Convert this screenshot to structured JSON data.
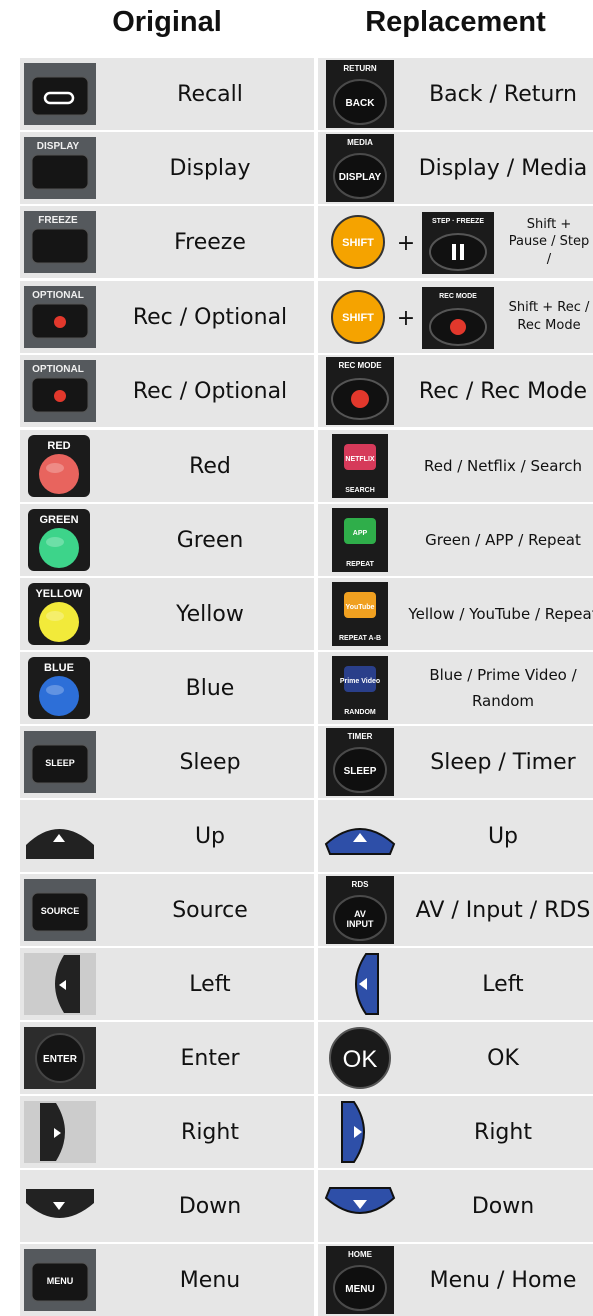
{
  "headers": {
    "original": "Original",
    "replacement": "Replacement"
  },
  "rows": [
    {
      "orig": {
        "label": "Recall",
        "key": "recall-button-icon"
      },
      "repl": {
        "label": "Back / Return",
        "key": "back-return-button-icon",
        "top": "RETURN",
        "face": "BACK"
      }
    },
    {
      "orig": {
        "label": "Display",
        "key": "display-button-icon",
        "top": "DISPLAY"
      },
      "repl": {
        "label": "Display / Media",
        "key": "display-media-button-icon",
        "top": "MEDIA",
        "face": "DISPLAY"
      }
    },
    {
      "orig": {
        "label": "Freeze",
        "key": "freeze-button-icon",
        "top": "FREEZE"
      },
      "repl": {
        "label": "Shift + Pause / Step /",
        "key": "shift-pause-button-icon",
        "face": "SHIFT",
        "top2": "STEP · FREEZE",
        "plus": "+"
      }
    },
    {
      "orig": {
        "label": "Rec / Optional",
        "key": "optional-rec-button-icon",
        "top": "OPTIONAL"
      },
      "repl": {
        "label": "Shift + Rec / Rec Mode",
        "key": "shift-rec-mode-button-icon",
        "face": "SHIFT",
        "top2": "REC MODE",
        "plus": "+"
      }
    },
    {
      "orig": {
        "label": "Rec / Optional",
        "key": "optional-rec-button-icon",
        "top": "OPTIONAL"
      },
      "repl": {
        "label": "Rec / Rec Mode",
        "key": "rec-mode-button-icon",
        "top": "REC MODE"
      }
    },
    {
      "orig": {
        "label": "Red",
        "key": "red-button-icon",
        "top": "RED"
      },
      "repl": {
        "label": "Red / Netflix / Search",
        "key": "netflix-search-button-icon",
        "face": "NETFLIX",
        "bottom": "SEARCH"
      }
    },
    {
      "orig": {
        "label": "Green",
        "key": "green-button-icon",
        "top": "GREEN"
      },
      "repl": {
        "label": "Green / APP / Repeat",
        "key": "app-repeat-button-icon",
        "face": "APP",
        "bottom": "REPEAT"
      }
    },
    {
      "orig": {
        "label": "Yellow",
        "key": "yellow-button-icon",
        "top": "YELLOW"
      },
      "repl": {
        "label": "Yellow / YouTube / Repeat",
        "key": "youtube-repeat-button-icon",
        "face": "YouTube",
        "bottom": "REPEAT A-B"
      }
    },
    {
      "orig": {
        "label": "Blue",
        "key": "blue-button-icon",
        "top": "BLUE"
      },
      "repl": {
        "label": "Blue / Prime Video / Random",
        "key": "prime-video-random-button-icon",
        "face": "Prime Video",
        "bottom": "RANDOM"
      }
    },
    {
      "orig": {
        "label": "Sleep",
        "key": "sleep-button-icon",
        "face": "SLEEP"
      },
      "repl": {
        "label": "Sleep / Timer",
        "key": "sleep-timer-button-icon",
        "top": "TIMER",
        "face": "SLEEP"
      }
    },
    {
      "orig": {
        "label": "Up",
        "key": "up-arrow-button-icon"
      },
      "repl": {
        "label": "Up",
        "key": "up-arrow-blue-button-icon"
      }
    },
    {
      "orig": {
        "label": "Source",
        "key": "source-button-icon",
        "face": "SOURCE"
      },
      "repl": {
        "label": "AV / Input / RDS",
        "key": "av-input-rds-button-icon",
        "top": "RDS",
        "face": "AV INPUT"
      }
    },
    {
      "orig": {
        "label": "Left",
        "key": "left-arrow-button-icon"
      },
      "repl": {
        "label": "Left",
        "key": "left-arrow-blue-button-icon"
      }
    },
    {
      "orig": {
        "label": "Enter",
        "key": "enter-button-icon",
        "face": "ENTER"
      },
      "repl": {
        "label": "OK",
        "key": "ok-button-icon",
        "face": "OK"
      }
    },
    {
      "orig": {
        "label": "Right",
        "key": "right-arrow-button-icon"
      },
      "repl": {
        "label": "Right",
        "key": "right-arrow-blue-button-icon"
      }
    },
    {
      "orig": {
        "label": "Down",
        "key": "down-arrow-button-icon"
      },
      "repl": {
        "label": "Down",
        "key": "down-arrow-blue-button-icon"
      }
    },
    {
      "orig": {
        "label": "Menu",
        "key": "menu-button-icon",
        "face": "MENU"
      },
      "repl": {
        "label": "Menu / Home",
        "key": "menu-home-button-icon",
        "top": "HOME",
        "face": "MENU"
      }
    }
  ]
}
